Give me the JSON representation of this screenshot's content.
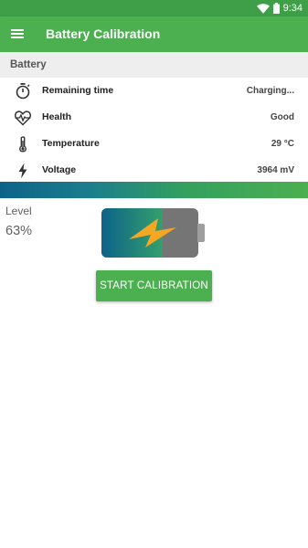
{
  "status_bar": {
    "time": "9:34"
  },
  "app_bar": {
    "title": "Battery Calibration",
    "menu_icon": "hamburger-menu-icon"
  },
  "section": {
    "title": "Battery"
  },
  "rows": [
    {
      "icon": "timer-icon",
      "label": "Remaining time",
      "value": "Charging..."
    },
    {
      "icon": "heart-pulse-icon",
      "label": "Health",
      "value": "Good"
    },
    {
      "icon": "thermometer-icon",
      "label": "Temperature",
      "value": "29 °C"
    },
    {
      "icon": "lightning-bolt-icon",
      "label": "Voltage",
      "value": "3964 mV"
    }
  ],
  "level": {
    "label": "Level",
    "value": "63%",
    "fraction": 0.63
  },
  "calibrate_button": {
    "label": "START CALIBRATION"
  },
  "colors": {
    "primary": "#4caf50",
    "primary_dark": "#3f9f48",
    "gradient_start": "#0d6389",
    "gradient_end": "#4caf50",
    "battery_empty": "#757575",
    "bolt": "#f5a623"
  }
}
